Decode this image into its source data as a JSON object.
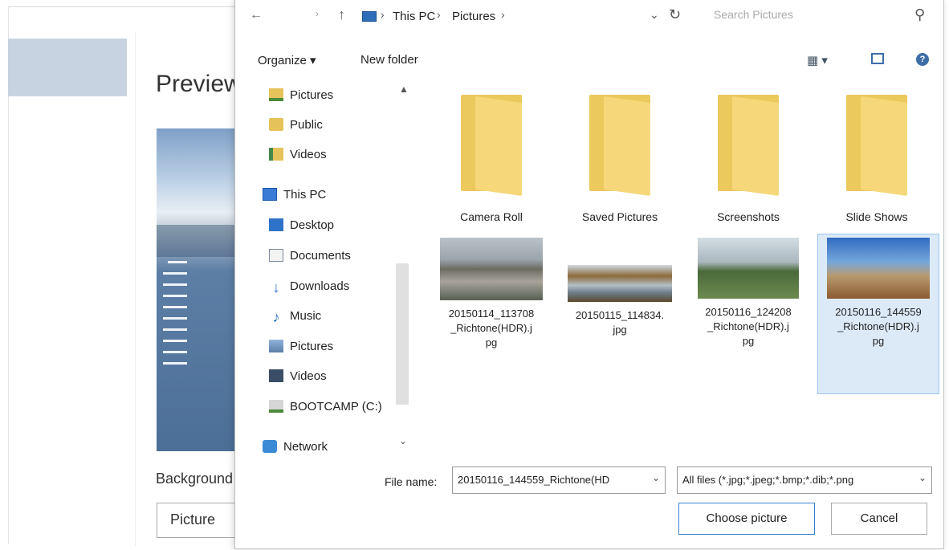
{
  "settings": {
    "preview_heading": "Preview",
    "background_label": "Background",
    "background_value": "Picture"
  },
  "dialog": {
    "address": {
      "back": "←",
      "forward": "›",
      "up": "↑",
      "this_pc": "This PC",
      "pictures": "Pictures",
      "search_placeholder": "Search Pictures"
    },
    "toolbar": {
      "organize": "Organize ▾",
      "new_folder": "New folder"
    },
    "nav": [
      {
        "label": "Pictures",
        "icon": "pictures-folder-icon"
      },
      {
        "label": "Public",
        "icon": "public-folder-icon"
      },
      {
        "label": "Videos",
        "icon": "videos-folder-icon"
      },
      {
        "label": "This PC",
        "icon": "computer-icon"
      },
      {
        "label": "Desktop",
        "icon": "desktop-icon"
      },
      {
        "label": "Documents",
        "icon": "documents-icon"
      },
      {
        "label": "Downloads",
        "icon": "downloads-icon"
      },
      {
        "label": "Music",
        "icon": "music-icon"
      },
      {
        "label": "Pictures",
        "icon": "pictures-icon"
      },
      {
        "label": "Videos",
        "icon": "videos-icon"
      },
      {
        "label": "BOOTCAMP (C:)",
        "icon": "drive-icon"
      },
      {
        "label": "Network",
        "icon": "network-icon"
      }
    ],
    "folders": [
      "Camera Roll",
      "Saved Pictures",
      "Screenshots",
      "Slide Shows"
    ],
    "files": [
      {
        "line1": "20150114_113708",
        "line2": "_Richtone(HDR).j",
        "line3": "pg"
      },
      {
        "line1": "20150115_114834.",
        "line2": "jpg",
        "line3": ""
      },
      {
        "line1": "20150116_124208",
        "line2": "_Richtone(HDR).j",
        "line3": "pg"
      },
      {
        "line1": "20150116_144559",
        "line2": "_Richtone(HDR).j",
        "line3": "pg"
      }
    ],
    "file_name_label": "File name:",
    "file_name_value": "20150116_144559_Richtone(HD",
    "file_type_value": "All files (*.jpg;*.jpeg;*.bmp;*.dib;*.png",
    "choose_button": "Choose picture",
    "cancel_button": "Cancel",
    "accent_color": "#3c7fd1",
    "selection_color": "#dceaf8"
  }
}
